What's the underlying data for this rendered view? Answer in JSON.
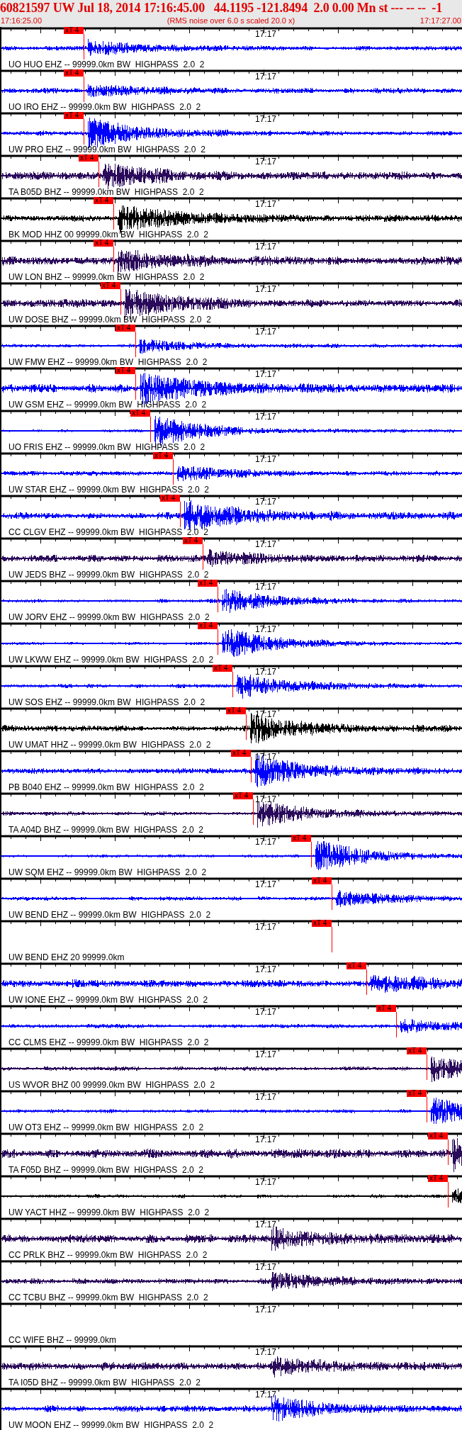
{
  "header": {
    "title": "60821597 UW Jul 18, 2014 17:16:45.00   44.1195 -121.8494  2.0 0.00 Mn st --- -- --  -1",
    "start_time": "17:16:25.00",
    "note": "(RMS noise over 6.0 s scaled 20.0 x)",
    "end_time": "17:17:27.00"
  },
  "traces": [
    {
      "kind": "waveform",
      "time_mark": "17:17",
      "label": "UO HUO EHZ -- 99999.0km BW  HIGHPASS  2.0  2",
      "color": "#0000ff",
      "pick": "xT 4"
    },
    {
      "kind": "waveform",
      "time_mark": "17:17",
      "label": "UO IRO EHZ -- 99999.0km BW  HIGHPASS  2.0  2",
      "color": "#0000ff",
      "pick": "xT 4"
    },
    {
      "kind": "waveform",
      "time_mark": "17:17",
      "label": "UW PRO EHZ -- 99999.0km BW  HIGHPASS  2.0  2",
      "color": "#0000ff",
      "pick": "xT 4"
    },
    {
      "kind": "waveform",
      "time_mark": "17:17",
      "label": "TA B05D BHZ -- 99999.0km BW  HIGHPASS  2.0  2",
      "color": "#2a0a5a",
      "pick": "xT 4"
    },
    {
      "kind": "waveform",
      "time_mark": "17:17",
      "label": "BK MOD HHZ 00 99999.0km BW  HIGHPASS  2.0  2",
      "color": "#000000",
      "pick": "xT 4"
    },
    {
      "kind": "waveform",
      "time_mark": "17:17",
      "label": "UW LON BHZ -- 99999.0km BW  HIGHPASS  2.0  2",
      "color": "#2a0a5a",
      "pick": "xT 4"
    },
    {
      "kind": "waveform",
      "time_mark": "17:17",
      "label": "UW DOSE BHZ -- 99999.0km BW  HIGHPASS  2.0  2",
      "color": "#2a0a5a",
      "pick": "xT 4"
    },
    {
      "kind": "waveform",
      "time_mark": "17:17",
      "label": "UW FMW EHZ -- 99999.0km BW  HIGHPASS  2.0  2",
      "color": "#0000ff",
      "pick": "xT 4"
    },
    {
      "kind": "waveform",
      "time_mark": "17:17",
      "label": "UW GSM EHZ -- 99999.0km BW  HIGHPASS  2.0  2",
      "color": "#0000ff",
      "pick": "xT 4"
    },
    {
      "kind": "waveform",
      "time_mark": "17:17",
      "label": "UO FRIS EHZ -- 99999.0km BW  HIGHPASS  2.0  2",
      "color": "#0000ff",
      "pick": "xT 4"
    },
    {
      "kind": "waveform",
      "time_mark": "17:17",
      "label": "UW STAR EHZ -- 99999.0km BW  HIGHPASS  2.0  2",
      "color": "#0000ff",
      "pick": "xT 4"
    },
    {
      "kind": "waveform",
      "time_mark": "17:17",
      "label": "CC CLGV EHZ -- 99999.0km BW  HIGHPASS  2.0  2",
      "color": "#0000ff",
      "pick": "xT 4"
    },
    {
      "kind": "waveform",
      "time_mark": "17:17",
      "label": "UW JEDS BHZ -- 99999.0km BW  HIGHPASS  2.0  2",
      "color": "#2a0a5a",
      "pick": "xT 4"
    },
    {
      "kind": "waveform",
      "time_mark": "17:17",
      "label": "UW JORV EHZ -- 99999.0km BW  HIGHPASS  2.0  2",
      "color": "#0000ff",
      "pick": "xT 4"
    },
    {
      "kind": "waveform",
      "time_mark": "17:17",
      "label": "UW LKWW EHZ -- 99999.0km BW  HIGHPASS  2.0  2",
      "color": "#0000ff",
      "pick": "xT 4"
    },
    {
      "kind": "waveform",
      "time_mark": "17:17",
      "label": "UW SOS EHZ -- 99999.0km BW  HIGHPASS  2.0  2",
      "color": "#0000ff",
      "pick": "xT 4"
    },
    {
      "kind": "waveform",
      "time_mark": "17:17",
      "label": "UW UMAT HHZ -- 99999.0km BW  HIGHPASS  2.0  2",
      "color": "#000000",
      "pick": "xT 4"
    },
    {
      "kind": "waveform",
      "time_mark": "17:17",
      "label": "PB B040 EHZ -- 99999.0km BW  HIGHPASS  2.0  2",
      "color": "#0000ff",
      "pick": "xT 4"
    },
    {
      "kind": "waveform",
      "time_mark": "17:17",
      "label": "TA A04D BHZ -- 99999.0km BW  HIGHPASS  2.0  2",
      "color": "#2a0a5a",
      "pick": "xT 4"
    },
    {
      "kind": "waveform",
      "time_mark": "17:17",
      "label": "UW SQM EHZ -- 99999.0km BW  HIGHPASS  2.0  2",
      "color": "#0000ff",
      "pick": "xT 4"
    },
    {
      "kind": "waveform",
      "time_mark": "17:17",
      "label": "UW BEND EHZ -- 99999.0km BW  HIGHPASS  2.0  2",
      "color": "#0000ff",
      "pick": "xT 4"
    },
    {
      "kind": "blank",
      "time_mark": "17:17",
      "label": "UW BEND EHZ 20 99999.0km",
      "pick": "xT 4"
    },
    {
      "kind": "waveform",
      "time_mark": "17:17",
      "label": "UW IONE EHZ -- 99999.0km BW  HIGHPASS  2.0  2",
      "color": "#0000ff",
      "pick": "xT 4"
    },
    {
      "kind": "waveform",
      "time_mark": "17:17",
      "label": "CC CLMS EHZ -- 99999.0km BW  HIGHPASS  2.0  2",
      "color": "#0000ff",
      "pick": "xT 4"
    },
    {
      "kind": "waveform",
      "time_mark": "17:17",
      "label": "US WVOR BHZ 00 99999.0km BW  HIGHPASS  2.0  2",
      "color": "#2a0a5a",
      "pick": "xT 4"
    },
    {
      "kind": "waveform",
      "time_mark": "17:17",
      "label": "UW OT3 EHZ -- 99999.0km BW  HIGHPASS  2.0  2",
      "color": "#0000ff",
      "pick": "xT 4"
    },
    {
      "kind": "waveform",
      "time_mark": "17:17",
      "label": "TA F05D BHZ -- 99999.0km BW  HIGHPASS  2.0  2",
      "color": "#2a0a5a",
      "pick": "xT 4"
    },
    {
      "kind": "waveform",
      "time_mark": "17:17",
      "label": "UW YACT HHZ -- 99999.0km BW  HIGHPASS  2.0  2",
      "color": "#000000",
      "pick": "xT 4"
    },
    {
      "kind": "waveform",
      "time_mark": "17:17",
      "label": "CC PRLK BHZ -- 99999.0km BW  HIGHPASS  2.0  2",
      "color": "#2a0a5a"
    },
    {
      "kind": "waveform",
      "time_mark": "17:17",
      "label": "CC TCBU BHZ -- 99999.0km BW  HIGHPASS  2.0  2",
      "color": "#2a0a5a"
    },
    {
      "kind": "blank",
      "time_mark": "17:17",
      "label": "CC WIFE BHZ -- 99999.0km"
    },
    {
      "kind": "waveform",
      "time_mark": "17:17",
      "label": "TA I05D BHZ -- 99999.0km BW  HIGHPASS  2.0  2",
      "color": "#2a0a5a"
    },
    {
      "kind": "waveform",
      "time_mark": "17:17",
      "label": "UW MOON EHZ -- 99999.0km BW  HIGHPASS  2.0  2",
      "color": "#0000ff"
    }
  ]
}
